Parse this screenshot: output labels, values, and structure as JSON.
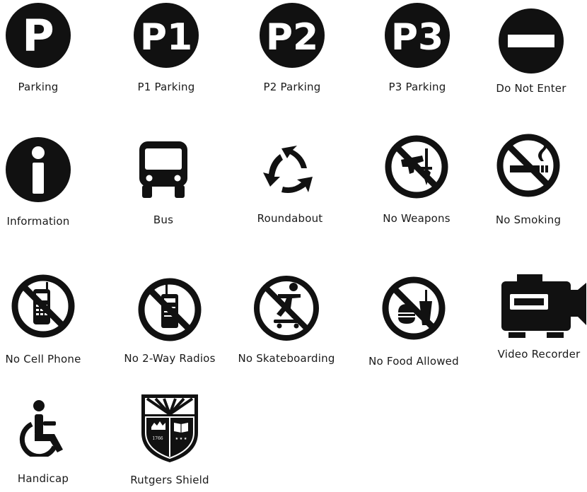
{
  "icons": [
    {
      "label": "Parking",
      "icon": "parking-icon"
    },
    {
      "label": "P1 Parking",
      "icon": "p1-parking-icon"
    },
    {
      "label": "P2 Parking",
      "icon": "p2-parking-icon"
    },
    {
      "label": "P3 Parking",
      "icon": "p3-parking-icon"
    },
    {
      "label": "Do Not Enter",
      "icon": "do-not-enter-icon"
    },
    {
      "label": "Information",
      "icon": "information-icon"
    },
    {
      "label": "Bus",
      "icon": "bus-icon"
    },
    {
      "label": "Roundabout",
      "icon": "roundabout-icon"
    },
    {
      "label": "No Weapons",
      "icon": "no-weapons-icon"
    },
    {
      "label": "No Smoking",
      "icon": "no-smoking-icon"
    },
    {
      "label": "No Cell Phone",
      "icon": "no-cell-phone-icon"
    },
    {
      "label": "No 2-Way Radios",
      "icon": "no-radios-icon"
    },
    {
      "label": "No Skateboarding",
      "icon": "no-skateboarding-icon"
    },
    {
      "label": "No Food Allowed",
      "icon": "no-food-icon"
    },
    {
      "label": "Video Recorder",
      "icon": "video-recorder-icon"
    },
    {
      "label": "Handicap",
      "icon": "handicap-icon"
    },
    {
      "label": "Rutgers Shield",
      "icon": "rutgers-shield-icon"
    }
  ],
  "shield": {
    "year": "1766",
    "stars": "★ ★ ★"
  },
  "colors": {
    "ink": "#111111",
    "background": "#ffffff"
  }
}
